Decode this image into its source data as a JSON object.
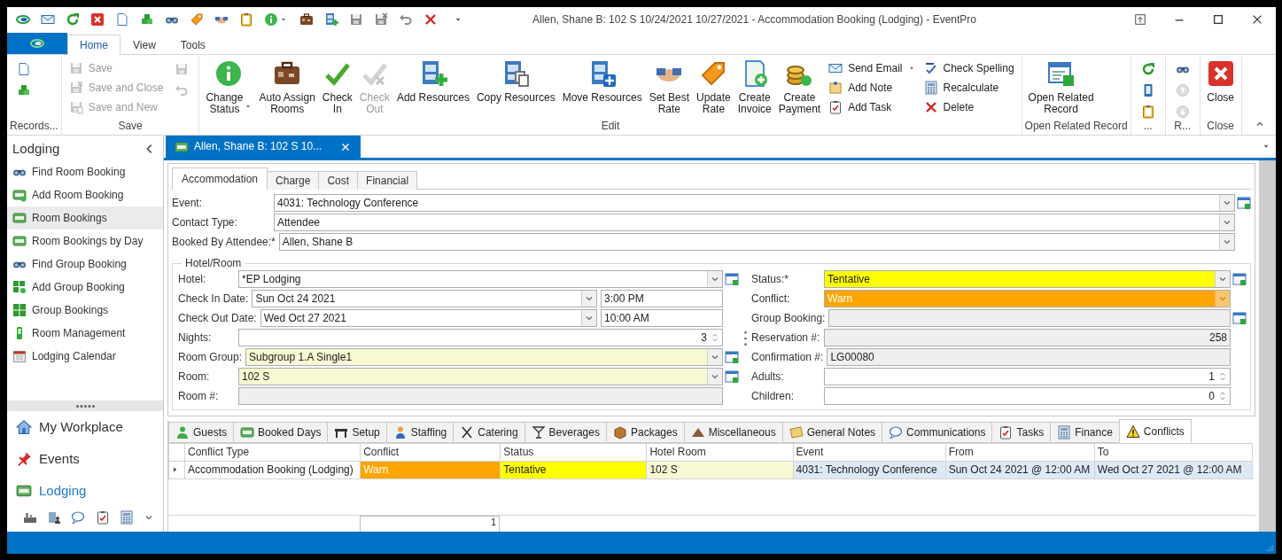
{
  "window": {
    "title": "Allen, Shane B: 102 S 10/24/2021 10/27/2021  - Accommodation Booking (Lodging) - EventPro"
  },
  "ribbon_tabs": [
    {
      "label": "Home",
      "selected": true
    },
    {
      "label": "View",
      "selected": false
    },
    {
      "label": "Tools",
      "selected": false
    }
  ],
  "ribbon_groups": [
    {
      "label": "Records...",
      "items": [
        {
          "kind": "icon",
          "disabled": false
        },
        {
          "kind": "icon",
          "disabled": false
        }
      ]
    },
    {
      "label": "Save",
      "items": [
        {
          "kind": "small",
          "label": "Save",
          "disabled": true
        },
        {
          "kind": "small",
          "label": "Save and Close",
          "disabled": true
        },
        {
          "kind": "small",
          "label": "Save and New",
          "disabled": true
        },
        {
          "kind": "icon",
          "disabled": true
        },
        {
          "kind": "icon",
          "disabled": true
        }
      ]
    },
    {
      "label": "Edit",
      "items": [
        {
          "kind": "large",
          "label": "Change\nStatus",
          "dropdown": true,
          "disabled": false
        },
        {
          "kind": "large",
          "label": "Auto Assign\nRooms",
          "disabled": false
        },
        {
          "kind": "large",
          "label": "Check\nIn",
          "disabled": false
        },
        {
          "kind": "large",
          "label": "Check\nOut",
          "disabled": true
        },
        {
          "kind": "large",
          "label": "Add Resources",
          "disabled": false
        },
        {
          "kind": "large",
          "label": "Copy Resources",
          "disabled": false
        },
        {
          "kind": "large",
          "label": "Move Resources",
          "disabled": false
        },
        {
          "kind": "large",
          "label": "Set Best\nRate",
          "disabled": false
        },
        {
          "kind": "large",
          "label": "Update\nRate",
          "disabled": false
        },
        {
          "kind": "large",
          "label": "Create\nInvoice",
          "disabled": false
        },
        {
          "kind": "large",
          "label": "Create\nPayment",
          "disabled": false
        },
        {
          "kind": "small",
          "label": "Send Email",
          "dropdown": true,
          "disabled": false
        },
        {
          "kind": "small",
          "label": "Add Note",
          "disabled": false
        },
        {
          "kind": "small",
          "label": "Add Task",
          "disabled": false
        },
        {
          "kind": "small",
          "label": "Check Spelling",
          "disabled": false
        },
        {
          "kind": "small",
          "label": "Recalculate",
          "disabled": false
        },
        {
          "kind": "small",
          "label": "Delete",
          "disabled": false
        }
      ]
    },
    {
      "label": "Open Related Record",
      "items": [
        {
          "kind": "large",
          "label": "Open Related\nRecord",
          "disabled": false
        }
      ]
    },
    {
      "label": "...",
      "items": [
        {
          "kind": "icon",
          "disabled": false
        },
        {
          "kind": "icon",
          "disabled": false
        },
        {
          "kind": "icon",
          "disabled": false
        }
      ]
    },
    {
      "label": "R...",
      "items": [
        {
          "kind": "icon",
          "disabled": false
        },
        {
          "kind": "icon",
          "disabled": true
        },
        {
          "kind": "icon",
          "disabled": true
        }
      ]
    },
    {
      "label": "Close",
      "items": [
        {
          "kind": "large",
          "label": "Close",
          "disabled": false
        }
      ]
    }
  ],
  "sidebar": {
    "title": "Lodging",
    "items": [
      {
        "label": "Find Room Booking",
        "selected": false
      },
      {
        "label": "Add Room Booking",
        "selected": false
      },
      {
        "label": "Room Bookings",
        "selected": true
      },
      {
        "label": "Room Bookings by Day",
        "selected": false
      },
      {
        "label": "Find Group Booking",
        "selected": false
      },
      {
        "label": "Add Group Booking",
        "selected": false
      },
      {
        "label": "Group Bookings",
        "selected": false
      },
      {
        "label": "Room Management",
        "selected": false
      },
      {
        "label": "Lodging Calendar",
        "selected": false
      }
    ],
    "nav": [
      {
        "label": "My Workplace",
        "selected": false
      },
      {
        "label": "Events",
        "selected": false
      },
      {
        "label": "Lodging",
        "selected": true
      }
    ]
  },
  "document_tabs": [
    {
      "label": "Allen, Shane B: 102 S 10...",
      "selected": true
    }
  ],
  "form_tabs": [
    {
      "label": "Accommodation",
      "selected": true
    },
    {
      "label": "Charge",
      "selected": false
    },
    {
      "label": "Cost",
      "selected": false
    },
    {
      "label": "Financial",
      "selected": false
    }
  ],
  "fields": [
    {
      "label": "Event:",
      "kind": "combo",
      "value": "4031: Technology Conference",
      "readonly": false,
      "lookup": true
    },
    {
      "label": "Contact Type:",
      "kind": "combo",
      "value": "Attendee",
      "readonly": false,
      "lookup": false
    },
    {
      "label": "Booked By Attendee:*",
      "kind": "combo",
      "value": "Allen, Shane B",
      "readonly": false,
      "lookup": false
    }
  ],
  "hotel_room": {
    "title": "Hotel/Room",
    "left": [
      {
        "label": "Hotel:",
        "kind": "combo",
        "value": "*EP Lodging",
        "readonly": false,
        "lookup": true
      },
      {
        "label": "Check In Date:",
        "kind": "datetime",
        "value": "Sun Oct 24 2021",
        "time": "3:00 PM",
        "readonly": false,
        "lookup": false
      },
      {
        "label": "Check Out Date:",
        "kind": "datetime",
        "value": "Wed Oct 27 2021",
        "time": "10:00 AM",
        "readonly": false,
        "lookup": false
      },
      {
        "label": "Nights:",
        "kind": "spin",
        "value": "3",
        "readonly": false,
        "lookup": false
      },
      {
        "label": "Room Group:",
        "kind": "combo",
        "value": "Subgroup 1.A Single1",
        "readonly": false,
        "lookup": true,
        "color": "#f8f8d2"
      },
      {
        "label": "Room:",
        "kind": "combo",
        "value": "102 S",
        "readonly": false,
        "lookup": true,
        "color": "#f8f8d2"
      },
      {
        "label": "Room #:",
        "kind": "text",
        "readonly": true,
        "lookup": false
      }
    ],
    "right": [
      {
        "label": "Status:*",
        "kind": "combo",
        "value": "Tentative",
        "readonly": false,
        "lookup": true,
        "color": "#ffff00"
      },
      {
        "label": "Conflict:",
        "kind": "combo",
        "value": "Warn",
        "readonly": true,
        "lookup": false,
        "color": "#ffa500"
      },
      {
        "label": "Group Booking:",
        "kind": "text",
        "readonly": true,
        "lookup": true
      },
      {
        "label": "Reservation #:",
        "kind": "number",
        "value": "258",
        "readonly": true,
        "lookup": false
      },
      {
        "label": "Confirmation #:",
        "kind": "text",
        "value": "LG00080",
        "readonly": true,
        "lookup": false
      },
      {
        "label": "Adults:",
        "kind": "spin",
        "value": "1",
        "readonly": false,
        "lookup": false
      },
      {
        "label": "Children:",
        "kind": "spin",
        "value": "0",
        "readonly": false,
        "lookup": false
      }
    ]
  },
  "detail_tabs": [
    {
      "label": "Guests",
      "selected": false
    },
    {
      "label": "Booked Days",
      "selected": false
    },
    {
      "label": "Setup",
      "selected": false
    },
    {
      "label": "Staffing",
      "selected": false
    },
    {
      "label": "Catering",
      "selected": false
    },
    {
      "label": "Beverages",
      "selected": false
    },
    {
      "label": "Packages",
      "selected": false
    },
    {
      "label": "Miscellaneous",
      "selected": false
    },
    {
      "label": "General Notes",
      "selected": false
    },
    {
      "label": "Communications",
      "selected": false
    },
    {
      "label": "Tasks",
      "selected": false
    },
    {
      "label": "Finance",
      "selected": false
    },
    {
      "label": "Conflicts",
      "selected": true
    }
  ],
  "grid": {
    "columns": [
      "Conflict Type",
      "Conflict",
      "Status",
      "Hotel Room",
      "Event",
      "From",
      "To"
    ],
    "rows": [
      {
        "selected": true,
        "cells": [
          {
            "text": "Accommodation Booking (Lodging)",
            "color": "#ffffff"
          },
          {
            "text": "Warn",
            "color": "#ffa500"
          },
          {
            "text": "Tentative",
            "color": "#ffff00"
          },
          {
            "text": "102 S",
            "color": "#f8f8d2"
          },
          {
            "text": "4031: Technology Conference",
            "color": "#dde9f6"
          },
          {
            "text": "Sun Oct 24 2021 @ 12:00 AM",
            "color": "#dde9f6"
          },
          {
            "text": "Wed Oct 27 2021 @ 12:00 AM",
            "color": "#dde9f6"
          }
        ]
      }
    ],
    "footer_total": "1"
  }
}
